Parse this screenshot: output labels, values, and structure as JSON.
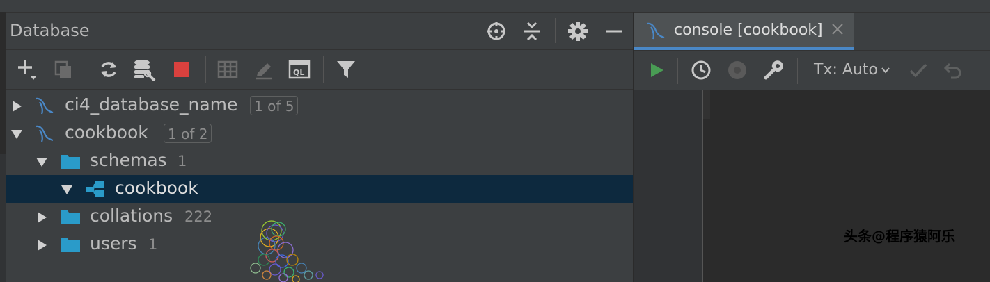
{
  "database_panel": {
    "title": "Database",
    "header_icons": [
      "crosshair-icon",
      "collapse-all-icon",
      "gear-icon",
      "minimize-icon"
    ],
    "toolbar_icons": [
      "add-icon",
      "duplicate-icon",
      "refresh-icon",
      "db-properties-icon",
      "stop-icon",
      "table-editor-icon",
      "edit-icon",
      "sql-console-icon",
      "filter-icon"
    ],
    "stop_color": "#d9413e",
    "tree": [
      {
        "label": "ci4_database_name",
        "badge": "1 of 5",
        "count": "",
        "expanded": false,
        "icon": "mysql-icon"
      },
      {
        "label": "cookbook",
        "badge": "1 of 2",
        "count": "",
        "expanded": true,
        "icon": "mysql-icon"
      },
      {
        "label": "schemas",
        "badge": "",
        "count": "1",
        "expanded": true,
        "icon": "folder-icon"
      },
      {
        "label": "cookbook",
        "badge": "",
        "count": "",
        "expanded": true,
        "icon": "schema-icon",
        "selected": true
      },
      {
        "label": "collations",
        "badge": "",
        "count": "222",
        "expanded": false,
        "icon": "folder-icon"
      },
      {
        "label": "users",
        "badge": "",
        "count": "1",
        "expanded": false,
        "icon": "folder-icon"
      }
    ]
  },
  "console_panel": {
    "tab_label": "console [cookbook]",
    "tab_icon": "mysql-icon",
    "tx_label": "Tx: Auto",
    "toolbar_icons": [
      "run-icon",
      "history-icon",
      "settings-disabled-icon",
      "wrench-icon",
      "commit-icon",
      "rollback-icon"
    ],
    "run_color": "#499c54",
    "accent": "#4a88c7"
  },
  "watermark": "头条@程序猿阿乐"
}
